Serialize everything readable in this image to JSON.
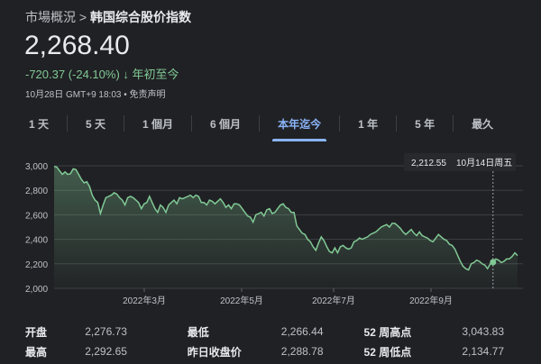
{
  "breadcrumb": {
    "parent": "市場概況",
    "sep": ">",
    "current": "韩国综合股价指数"
  },
  "price": "2,268.40",
  "change": {
    "value": "-720.37 (-24.10%)",
    "arrow": "↓",
    "period": "年初至今"
  },
  "meta": "10月28日 GMT+9 18:03 • 免责声明",
  "tabs": [
    {
      "label": "1 天"
    },
    {
      "label": "5 天"
    },
    {
      "label": "1 個月"
    },
    {
      "label": "6 個月"
    },
    {
      "label": "本年迄今",
      "active": true
    },
    {
      "label": "1 年"
    },
    {
      "label": "5 年"
    },
    {
      "label": "最久"
    }
  ],
  "colors": {
    "line": "#81c995",
    "accent": "#8ab4f8",
    "bg": "#202124"
  },
  "chart_data": {
    "type": "line",
    "ylim": [
      2000,
      3000
    ],
    "yticks": [
      "3,000",
      "2,800",
      "2,600",
      "2,400",
      "2,200",
      "2,000"
    ],
    "xticks": [
      "2022年3月",
      "2022年5月",
      "2022年7月",
      "2022年9月"
    ],
    "tooltip": {
      "value": "2,212.55",
      "date": "10月14日周五"
    },
    "values": [
      2995,
      2990,
      2960,
      2930,
      2950,
      2930,
      2935,
      2975,
      2970,
      2930,
      2890,
      2860,
      2870,
      2830,
      2760,
      2720,
      2700,
      2610,
      2680,
      2740,
      2750,
      2760,
      2780,
      2770,
      2740,
      2720,
      2680,
      2740,
      2750,
      2740,
      2720,
      2700,
      2650,
      2690,
      2700,
      2750,
      2700,
      2650,
      2620,
      2680,
      2660,
      2620,
      2680,
      2700,
      2720,
      2690,
      2740,
      2730,
      2740,
      2750,
      2760,
      2740,
      2760,
      2750,
      2700,
      2700,
      2680,
      2720,
      2710,
      2690,
      2710,
      2730,
      2700,
      2660,
      2680,
      2650,
      2690,
      2690,
      2680,
      2650,
      2620,
      2590,
      2580,
      2540,
      2600,
      2610,
      2620,
      2590,
      2640,
      2650,
      2610,
      2620,
      2650,
      2680,
      2690,
      2660,
      2650,
      2620,
      2620,
      2510,
      2480,
      2450,
      2440,
      2400,
      2380,
      2340,
      2310,
      2370,
      2420,
      2390,
      2340,
      2300,
      2290,
      2330,
      2290,
      2340,
      2350,
      2330,
      2320,
      2330,
      2380,
      2390,
      2410,
      2400,
      2410,
      2420,
      2440,
      2450,
      2460,
      2480,
      2500,
      2510,
      2520,
      2500,
      2530,
      2530,
      2510,
      2490,
      2460,
      2440,
      2460,
      2480,
      2450,
      2430,
      2460,
      2430,
      2420,
      2410,
      2390,
      2380,
      2410,
      2440,
      2420,
      2400,
      2390,
      2360,
      2350,
      2320,
      2270,
      2220,
      2180,
      2160,
      2150,
      2200,
      2210,
      2230,
      2220,
      2200,
      2190,
      2160,
      2200,
      2213,
      2240,
      2230,
      2210,
      2220,
      2240,
      2240,
      2260,
      2290,
      2268
    ],
    "tooltip_index": 161
  },
  "stats": [
    [
      {
        "label": "开盘",
        "value": "2,276.73"
      },
      {
        "label": "最低",
        "value": "2,266.44"
      },
      {
        "label": "52 周高点",
        "value": "3,043.83"
      }
    ],
    [
      {
        "label": "最高",
        "value": "2,292.65"
      },
      {
        "label": "昨日收盘价",
        "value": "2,288.78"
      },
      {
        "label": "52 周低点",
        "value": "2,134.77"
      }
    ]
  ]
}
